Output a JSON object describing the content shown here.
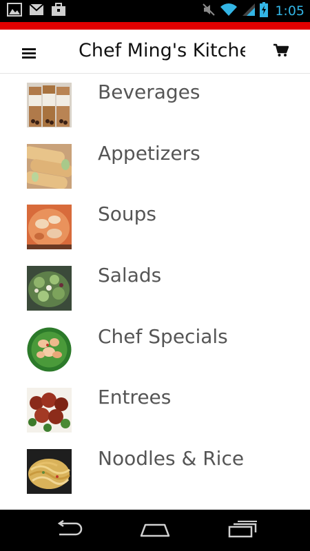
{
  "status_bar": {
    "time": "1:05",
    "left_icons": [
      "gallery-icon",
      "gmail-icon",
      "briefcase-icon"
    ],
    "right_icons": [
      "mute-icon",
      "wifi-icon",
      "signal-icon",
      "battery-charging-icon"
    ],
    "time_color": "#33b5e5"
  },
  "header": {
    "accent_color": "#e00000",
    "title": "Chef Ming's Kitchen",
    "menu_icon": "hamburger-menu-icon",
    "cart_icon": "shopping-cart-icon"
  },
  "categories": [
    {
      "label": "Beverages",
      "image": "bubble-tea-cups"
    },
    {
      "label": "Appetizers",
      "image": "spring-rolls"
    },
    {
      "label": "Soups",
      "image": "wonton-soup"
    },
    {
      "label": "Salads",
      "image": "green-salad"
    },
    {
      "label": "Chef Specials",
      "image": "shrimp-broccoli"
    },
    {
      "label": "Entrees",
      "image": "general-tso-chicken"
    },
    {
      "label": "Noodles & Rice",
      "image": "lo-mein"
    }
  ],
  "nav_bar": {
    "buttons": [
      "back-icon",
      "home-icon",
      "recent-apps-icon"
    ]
  }
}
